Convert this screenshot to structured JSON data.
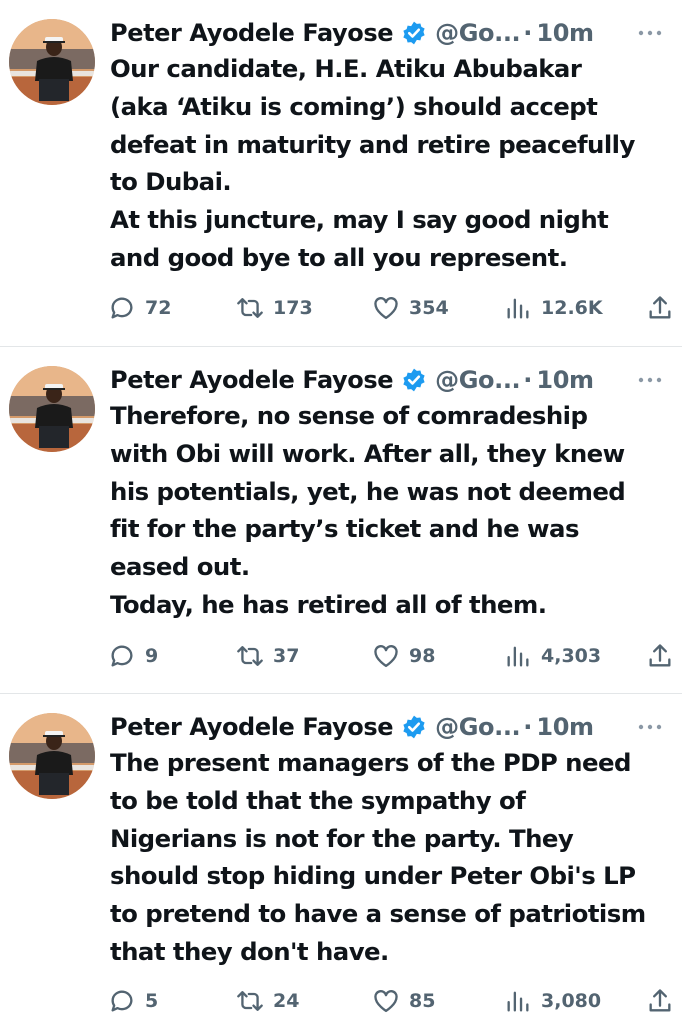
{
  "tweets": [
    {
      "author": "Peter Ayodele Fayose",
      "handle": "@Go...",
      "separator": "·",
      "time": "10m",
      "lines": [
        "Our candidate, H.E. Atiku Abubakar",
        "(aka ‘Atiku is coming’) should accept",
        "defeat in maturity and retire peacefully",
        "to Dubai.",
        "At this juncture, may I say good night",
        "and good bye to all you represent."
      ],
      "replies": "72",
      "retweets": "173",
      "likes": "354",
      "views": "12.6K"
    },
    {
      "author": "Peter Ayodele Fayose",
      "handle": "@Go...",
      "separator": "·",
      "time": "10m",
      "lines": [
        "Therefore, no sense of comradeship",
        "with Obi will work. After all, they knew",
        "his potentials, yet, he was not deemed",
        "fit for the party’s ticket and he was",
        "eased out.",
        "Today, he has retired all of them."
      ],
      "replies": "9",
      "retweets": "37",
      "likes": "98",
      "views": "4,303"
    },
    {
      "author": "Peter Ayodele Fayose",
      "handle": "@Go...",
      "separator": "·",
      "time": "10m",
      "lines": [
        "The present managers of the PDP need",
        "to be told that the sympathy of",
        "Nigerians is not for the party. They",
        "should stop hiding under Peter Obi's LP",
        "to pretend to have a sense of patriotism",
        "that they don't have."
      ],
      "replies": "5",
      "retweets": "24",
      "likes": "85",
      "views": "3,080"
    }
  ],
  "icons": {
    "verified": "verified-badge-icon",
    "more": "more-icon",
    "reply": "reply-icon",
    "retweet": "retweet-icon",
    "like": "like-icon",
    "views": "views-icon",
    "share": "share-icon"
  },
  "colors": {
    "text": "#0f1419",
    "secondary": "#536471",
    "verified": "#1d9bf0",
    "divider": "#e3e6e8"
  }
}
